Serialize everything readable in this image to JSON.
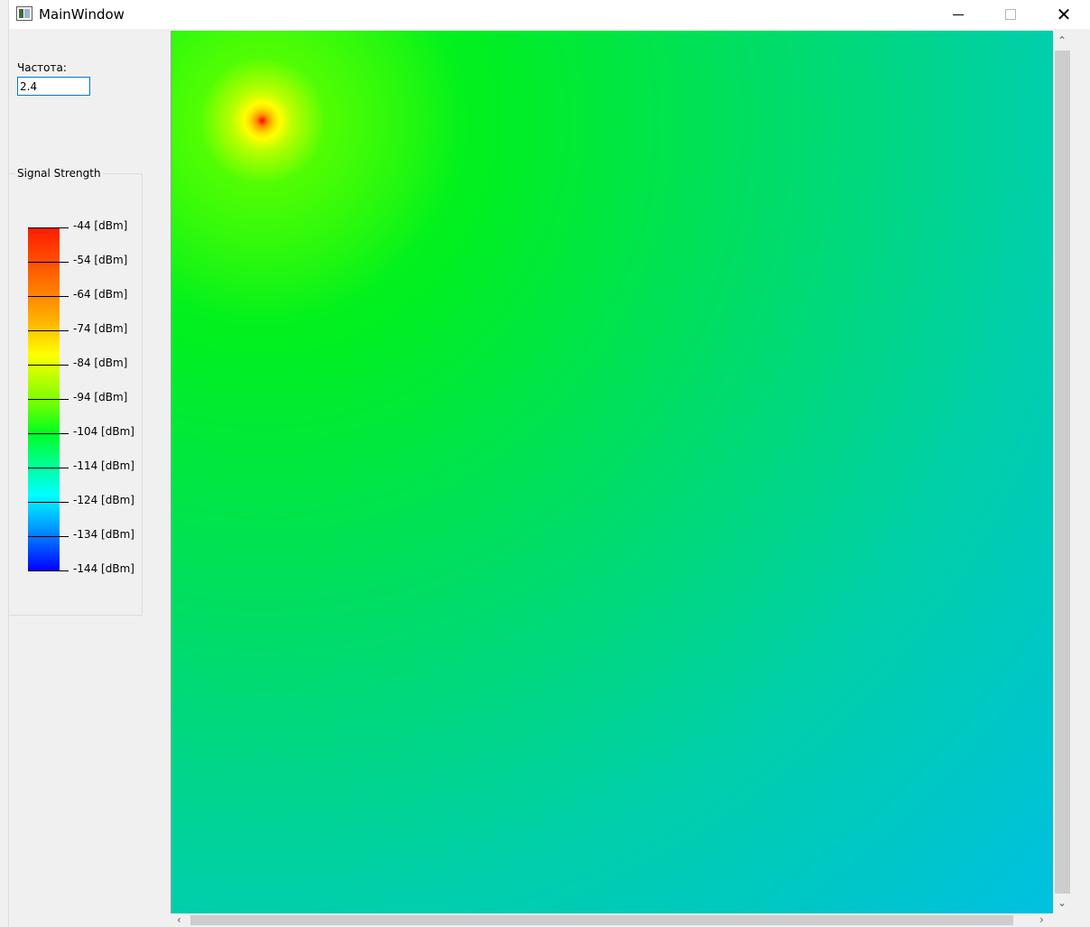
{
  "window": {
    "title": "MainWindow",
    "controls": {
      "minimize": "minimize",
      "maximize": "maximize",
      "close": "✕"
    }
  },
  "frequency": {
    "label": "Частота:",
    "value": "2.4"
  },
  "legend": {
    "title": "Signal Strength",
    "ticks": [
      "-44 [dBm]",
      "-54 [dBm]",
      "-64 [dBm]",
      "-74 [dBm]",
      "-84 [dBm]",
      "-94 [dBm]",
      "-104 [dBm]",
      "-114 [dBm]",
      "-124 [dBm]",
      "-134 [dBm]",
      "-144 [dBm]"
    ],
    "colors": [
      "#ff1a00",
      "#ff6a00",
      "#ffb000",
      "#ffff00",
      "#80ff00",
      "#00ff20",
      "#00ffa0",
      "#00ffff",
      "#00a0ff",
      "#0000ff"
    ]
  },
  "heatmap": {
    "description_source": "signal-strength-map",
    "peak_color": "#ff0000",
    "far_color": "#00bcff"
  },
  "scrollbars": {
    "up": "⌃",
    "down": "⌄",
    "left": "‹",
    "right": "›"
  }
}
